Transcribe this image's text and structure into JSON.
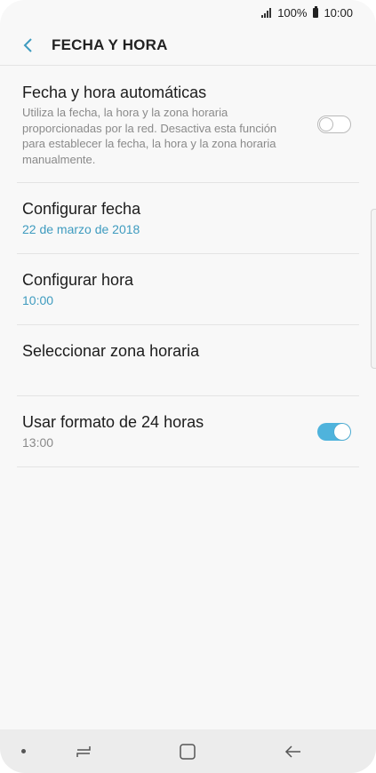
{
  "status_bar": {
    "battery": "100%",
    "time": "10:00"
  },
  "header": {
    "title": "FECHA Y HORA",
    "back_icon": "chevron-left-icon"
  },
  "settings": {
    "auto_datetime": {
      "title": "Fecha y hora automáticas",
      "description": "Utiliza la fecha, la hora y la zona horaria proporcionadas por la red. Desactiva esta función para establecer la fecha, la hora y la zona horaria manualmente.",
      "enabled": false
    },
    "set_date": {
      "title": "Configurar fecha",
      "value": "22 de marzo de 2018"
    },
    "set_time": {
      "title": "Configurar hora",
      "value": "10:00"
    },
    "time_zone": {
      "title": "Seleccionar zona horaria"
    },
    "format_24h": {
      "title": "Usar formato de 24 horas",
      "value": "13:00",
      "enabled": true
    }
  },
  "colors": {
    "accent": "#4fb3dc",
    "link": "#3e9bbf"
  }
}
